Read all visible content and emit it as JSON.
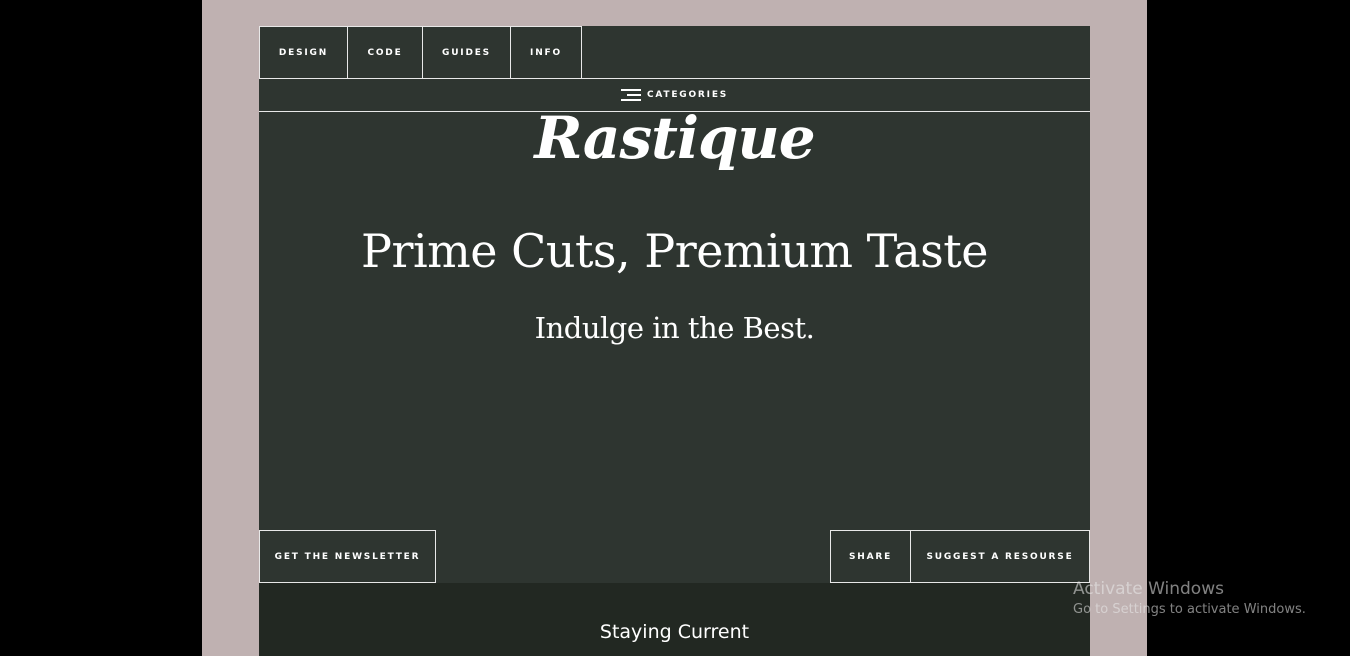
{
  "nav": {
    "items": [
      {
        "label": "DESIGN"
      },
      {
        "label": "CODE"
      },
      {
        "label": "GUIDES"
      },
      {
        "label": "INFO"
      }
    ],
    "categories_label": "CATEGORIES"
  },
  "hero": {
    "logo": "Rastique",
    "headline": "Prime Cuts, Premium Taste",
    "subline": "Indulge in the Best."
  },
  "actions": {
    "newsletter": "GET THE NEWSLETTER",
    "share": "SHARE",
    "suggest": "SUGGEST A RESOURSE"
  },
  "lower": {
    "title": "Staying Current"
  },
  "watermark": {
    "title": "Activate Windows",
    "subtitle": "Go to Settings to activate Windows."
  },
  "colors": {
    "outer_bg": "#000000",
    "page_bg": "#bfb1b1",
    "site_bg": "#2e3530",
    "lower_bg": "#222822",
    "text": "#ffffff"
  }
}
